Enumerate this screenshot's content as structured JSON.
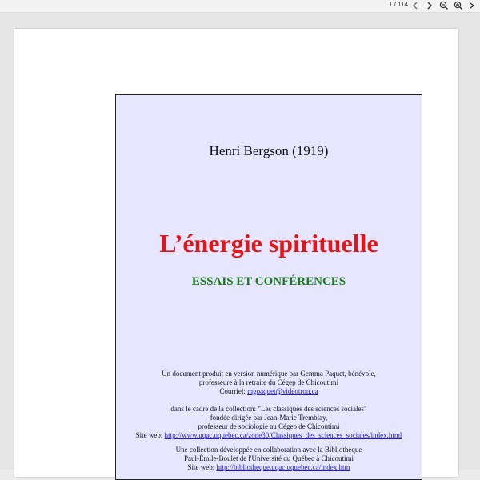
{
  "toolbar": {
    "page_indicator": "1 / 114",
    "icons": [
      "chevron-left-icon",
      "chevron-right-icon",
      "zoom-out-icon",
      "zoom-in-icon",
      "more-icon"
    ]
  },
  "document": {
    "author_line": "Henri Bergson (1919)",
    "title": "L’énergie spirituelle",
    "subtitle": "ESSAIS ET CONFÉRENCES",
    "block1": {
      "line1": "Un document produit en version numérique par Gemma Paquet, bénévole,",
      "line2": "professeure à la retraite du Cégep de Chicoutimi",
      "courriel_label": "Courriel: ",
      "courriel_link": "mgpaquet@videotron.ca"
    },
    "block2": {
      "line1": "dans le cadre de la collection: \"Les classiques des sciences sociales\"",
      "line2": "fondée dirigée par Jean-Marie Tremblay,",
      "line3": "professeur de sociologie au Cégep de Chicoutimi",
      "site_label": "Site web: ",
      "site_link": "http://www.uqac.uquebec.ca/zone30/Classiques_des_sciences_sociales/index.html"
    },
    "block3": {
      "line1": "Une collection développée en collaboration avec la Bibliothèque",
      "line2": "Paul-Émile-Boulet de l'Université du Québec à Chicoutimi",
      "site_label": "Site web: ",
      "site_link": "http://bibliotheque.uqac.uquebec.ca/index.htm"
    }
  },
  "colors": {
    "cover_bg": "#e6e6ff",
    "title": "#e11616",
    "subtitle": "#1a7a1a",
    "link": "#1a1adb"
  }
}
